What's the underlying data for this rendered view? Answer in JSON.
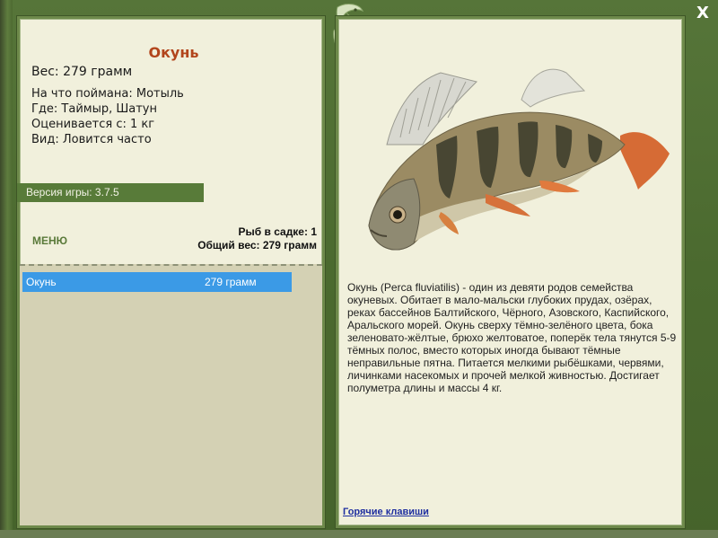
{
  "window": {
    "close_label": "X"
  },
  "fish": {
    "name": "Окунь",
    "weight_line": "Вес: 279 грамм",
    "info": [
      "На что поймана: Мотыль",
      "Где: Таймыр, Шатун",
      "Оценивается с: 1 кг",
      "Вид: Ловится часто"
    ],
    "description": "Окунь (Perca fluviatilis) - один из девяти родов семейства окуневых. Обитает в мало-мальски глубоких прудах, озёрах, реках бассейнов Балтийского, Чёрного, Азовского, Каспийского, Аральского морей. Окунь сверху тёмно-зелёного цвета, бока зеленовато-жёлтые, брюхо желтоватое, поперёк тела тянутся 5-9 тёмных полос, вместо которых иногда бывают тёмные неправильные пятна. Питается мелкими рыбёшками, червями, личинками насекомых и прочей мелкой живностью. Достигает полуметра длины и массы 4 кг."
  },
  "version": {
    "label": "Версия игры: 3.7.5"
  },
  "menu": {
    "label": "МЕНЮ"
  },
  "stats": {
    "fish_in_keepnet": "Рыб в садке: 1",
    "total_weight": "Общий вес: 279 грамм"
  },
  "catch_list": [
    {
      "name": "Окунь",
      "weight": "279 грамм"
    }
  ],
  "links": {
    "hotkeys": "Горячие клавиши"
  },
  "colors": {
    "frame": "#4d6a31",
    "panel": "#f1f0dc",
    "title": "#b2451c",
    "version_bar": "#587b39",
    "selected_row": "#3b9ae6",
    "link": "#1f2fa0"
  }
}
